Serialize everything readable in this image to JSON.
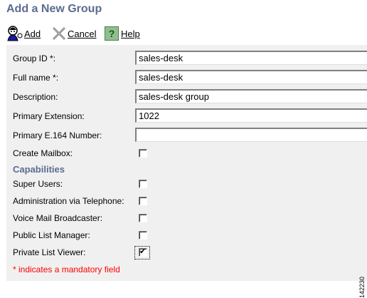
{
  "page": {
    "title": "Add a New Group"
  },
  "toolbar": {
    "add_label": "Add",
    "add_icon": "user-figure-icon",
    "cancel_label": "Cancel",
    "cancel_icon": "x-mark-icon",
    "help_label": "Help",
    "help_icon": "question-mark-icon"
  },
  "form": {
    "group_id": {
      "label": "Group ID *:",
      "value": "sales-desk"
    },
    "full_name": {
      "label": "Full name *:",
      "value": "sales-desk"
    },
    "description": {
      "label": "Description:",
      "value": "sales-desk group"
    },
    "primary_extension": {
      "label": "Primary Extension:",
      "value": "1022"
    },
    "primary_e164": {
      "label": "Primary E.164 Number:",
      "value": ""
    },
    "create_mailbox": {
      "label": "Create Mailbox:",
      "checked": false
    }
  },
  "capabilities": {
    "heading": "Capabilities",
    "super_users": {
      "label": "Super Users:",
      "checked": false
    },
    "admin_via_telephone": {
      "label": "Administration via Telephone:",
      "checked": false
    },
    "voice_mail_broadcaster": {
      "label": "Voice Mail Broadcaster:",
      "checked": false
    },
    "public_list_manager": {
      "label": "Public List Manager:",
      "checked": false
    },
    "private_list_viewer": {
      "label": "Private List Viewer:",
      "checked": true
    }
  },
  "footer": {
    "mandatory_note": "* indicates a mandatory field",
    "figure_number": "142230"
  },
  "colors": {
    "title": "#5b6c8f",
    "panel_bg": "#f0f0f0",
    "mandatory": "#ff0000"
  }
}
